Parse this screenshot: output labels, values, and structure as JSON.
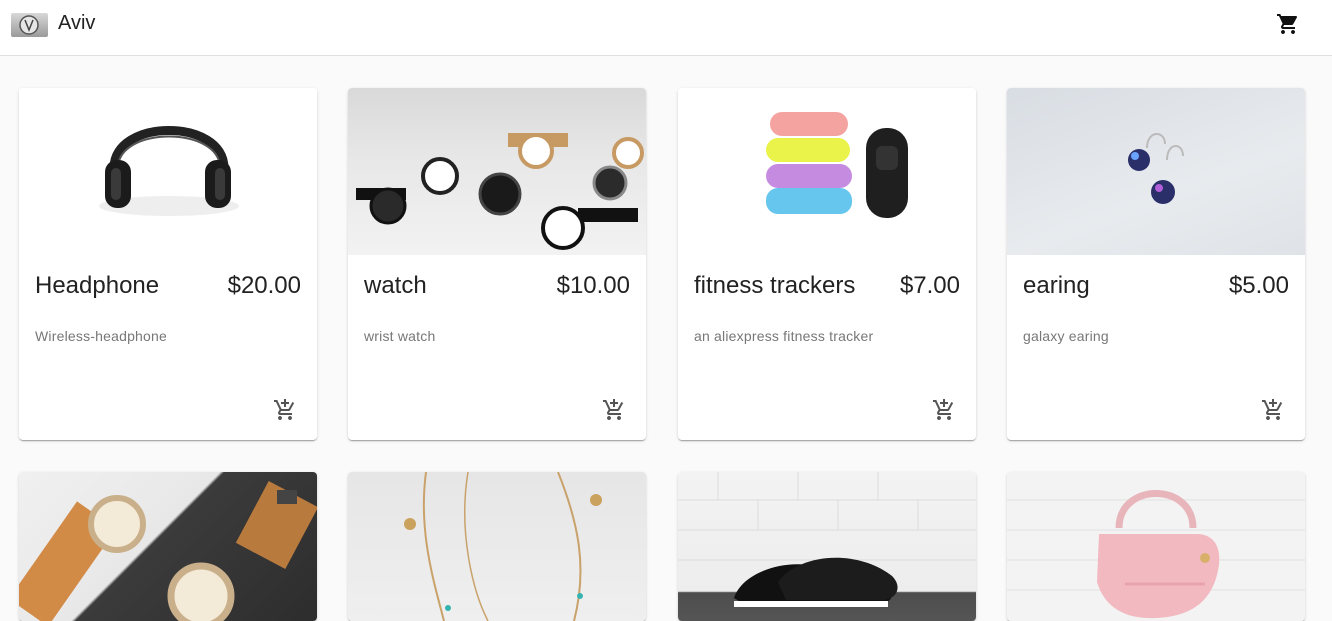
{
  "app": {
    "title": "Aviv"
  },
  "header": {
    "cart_icon": "shopping-cart-icon"
  },
  "products": [
    {
      "name": "Headphone",
      "price": "$20.00",
      "description": "Wireless-headphone"
    },
    {
      "name": "watch",
      "price": "$10.00",
      "description": "wrist watch"
    },
    {
      "name": "fitness trackers",
      "price": "$7.00",
      "description": "an aliexpress fitness tracker"
    },
    {
      "name": "earing",
      "price": "$5.00",
      "description": "galaxy earing"
    }
  ],
  "colors": {
    "appbar": "#ffffff",
    "background": "#fafafa",
    "icon": "#555555"
  }
}
